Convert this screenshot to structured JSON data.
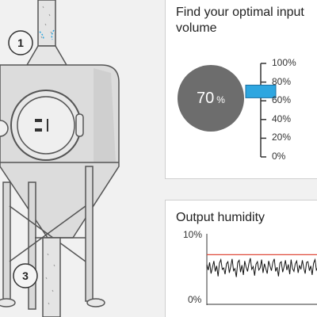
{
  "diagram": {
    "stage_labels": [
      "1",
      "3"
    ]
  },
  "input_panel": {
    "title": "Find your optimal input volume",
    "value": 70,
    "unit": "%",
    "slider_ticks": [
      "100%",
      "80%",
      "60%",
      "40%",
      "20%",
      "0%"
    ],
    "handle_color": "#2ea6e0"
  },
  "humidity_panel": {
    "title": "Output humidity",
    "y_ticks": [
      "10%",
      "0%"
    ],
    "threshold_color": "#e04a3a"
  },
  "chart_data": {
    "type": "line",
    "title": "Output humidity",
    "ylim": [
      0,
      10
    ],
    "y_ticks": [
      "0%",
      "10%"
    ],
    "threshold": 7,
    "series": [
      {
        "values": [
          5.6,
          4.8,
          5.9,
          4.3,
          5.2,
          6.1,
          4.6,
          5.4,
          3.9,
          5.8,
          6.3,
          4.9,
          5.1,
          4.2,
          5.7,
          6.0,
          4.4,
          5.3,
          6.4,
          4.7,
          5.0,
          3.8,
          5.9,
          6.2,
          4.5,
          5.5,
          4.1,
          6.1,
          5.2,
          4.6,
          5.8,
          6.5,
          4.9,
          5.3,
          4.0,
          5.6,
          6.0,
          4.8,
          5.1,
          6.3,
          4.4,
          5.7,
          5.0,
          4.3,
          6.1,
          5.4,
          4.7,
          5.9,
          6.4,
          4.6,
          5.2,
          3.9,
          5.8,
          6.0,
          4.5,
          5.3,
          6.2,
          4.8,
          5.6,
          4.2,
          6.3,
          5.0,
          4.6,
          5.7,
          6.1,
          4.4,
          5.5,
          4.9,
          6.2,
          5.1,
          4.3,
          5.9,
          6.0,
          4.7,
          5.4,
          4.1,
          5.8,
          6.3,
          4.8,
          5.2
        ]
      }
    ]
  }
}
